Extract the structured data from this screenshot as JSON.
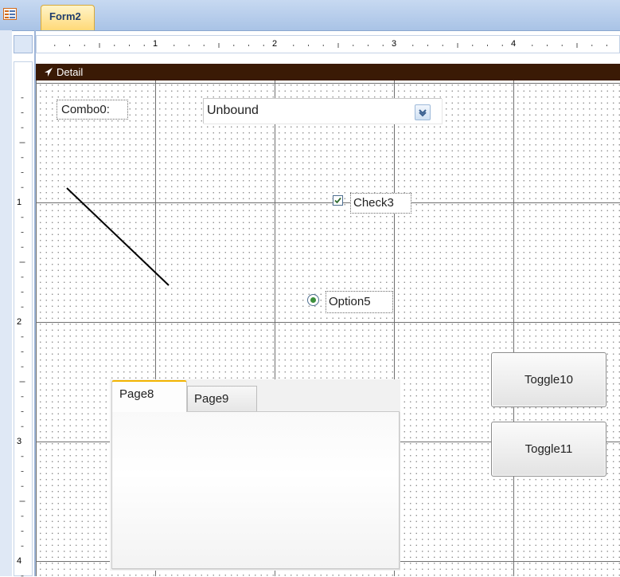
{
  "window": {
    "form_tab_title": "Form2",
    "form_icon": "form-view-icon"
  },
  "ruler": {
    "horizontal_numbers": [
      "1",
      "2",
      "3",
      "4"
    ],
    "vertical_numbers": [
      "1",
      "2",
      "3",
      "4"
    ]
  },
  "section": {
    "label": "Detail",
    "icon": "section-arrow-icon"
  },
  "controls": {
    "combo_label": "Combo0:",
    "combo_value": "Unbound",
    "combo_arrow_icon": "chevron-down-icon",
    "check_label": "Check3",
    "check_checked": true,
    "option_label": "Option5",
    "option_selected": true,
    "toggle1_label": "Toggle10",
    "toggle2_label": "Toggle11"
  },
  "tab_control": {
    "tabs": [
      {
        "label": "Page8",
        "active": true
      },
      {
        "label": "Page9",
        "active": false
      }
    ]
  },
  "colors": {
    "section_bar": "#3a1a05",
    "active_tab_accent": "#f2b400",
    "form_tab": "#ffd978"
  }
}
